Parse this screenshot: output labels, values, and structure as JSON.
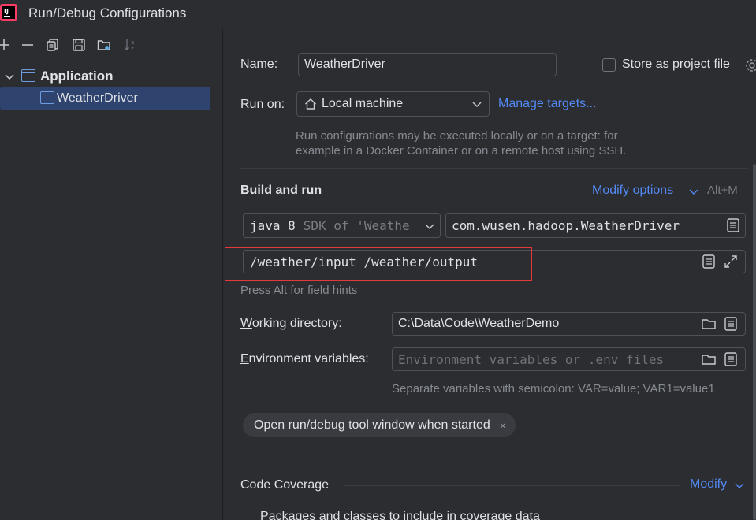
{
  "window": {
    "title": "Run/Debug Configurations"
  },
  "toolbar": {
    "icons": [
      "add-icon",
      "remove-icon",
      "copy-icon",
      "save-icon",
      "folder-add-icon",
      "sort-icon"
    ]
  },
  "tree": {
    "group_label": "Application",
    "items": [
      {
        "label": "WeatherDriver",
        "selected": true
      }
    ]
  },
  "form": {
    "name_label_prefix": "N",
    "name_label_rest": "ame:",
    "name_value": "WeatherDriver",
    "store_label": "Store as project file",
    "run_on_label": "Run on:",
    "run_on_value": "Local machine",
    "manage_targets": "Manage targets...",
    "run_on_hint_line1": "Run configurations may be executed locally or on a target: for",
    "run_on_hint_line2": "example in a Docker Container or on a remote host using SSH.",
    "build_run_title": "Build and run",
    "modify_options": "Modify options",
    "modify_shortcut": "Alt+M",
    "java_version": "java 8",
    "sdk_text": "SDK of 'Weathe",
    "main_class": "com.wusen.hadoop.WeatherDriver",
    "program_args": "/weather/input /weather/output",
    "field_hint": "Press Alt for field hints",
    "working_dir_prefix": "W",
    "working_dir_rest": "orking directory:",
    "working_dir_value": "C:\\Data\\Code\\WeatherDemo",
    "env_prefix": "E",
    "env_rest": "nvironment variables:",
    "env_placeholder": "Environment variables or .env files",
    "env_hint": "Separate variables with semicolon: VAR=value; VAR1=value1",
    "chip_label": "Open run/debug tool window when started",
    "chip_close": "×",
    "coverage_title": "Code Coverage",
    "coverage_modify": "Modify",
    "coverage_sub": "Packages and classes to include in coverage data"
  },
  "colors": {
    "background": "#2b2d30",
    "accent_link": "#548af7",
    "selection": "#2e436e",
    "highlight_box": "#e5383b"
  }
}
